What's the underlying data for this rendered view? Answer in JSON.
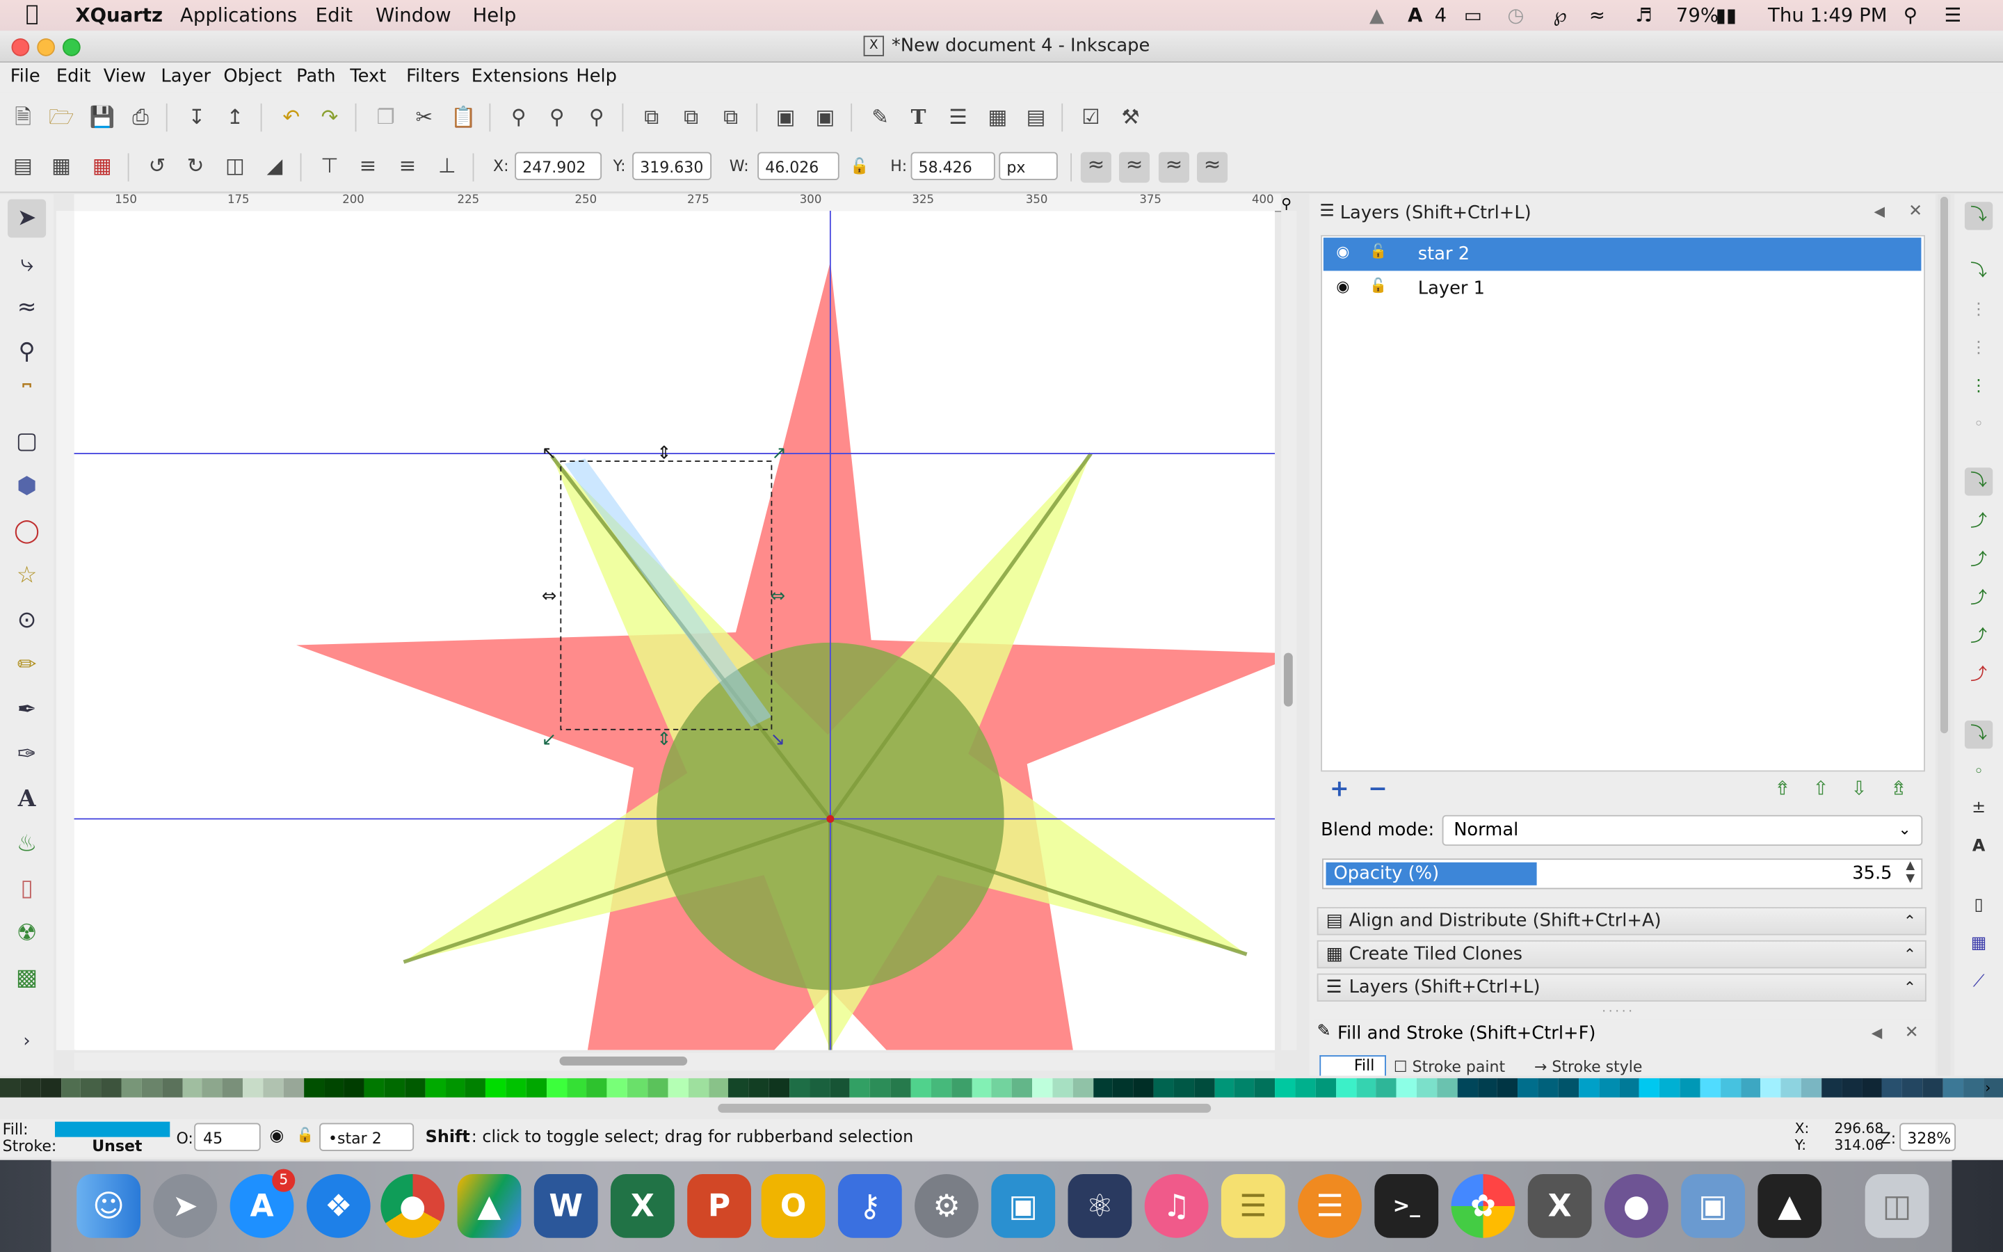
{
  "menubar": {
    "apple": "",
    "app": "XQuartz",
    "items": [
      "Applications",
      "Edit",
      "Window",
      "Help"
    ],
    "status": {
      "adobe_count": "4",
      "battery": "79%",
      "clock": "Thu 1:49 PM"
    }
  },
  "window": {
    "title": "*New document 4 - Inkscape"
  },
  "app_menu": [
    "File",
    "Edit",
    "View",
    "Layer",
    "Object",
    "Path",
    "Text",
    "Filters",
    "Extensions",
    "Help"
  ],
  "toolcontrols": {
    "x_label": "X:",
    "x_value": "247.902",
    "y_label": "Y:",
    "y_value": "319.630",
    "w_label": "W:",
    "w_value": "46.026",
    "h_label": "H:",
    "h_value": "58.426",
    "unit": "px"
  },
  "ruler_top_labels": [
    "150",
    "175",
    "200",
    "225",
    "250",
    "275",
    "300",
    "325",
    "350",
    "375",
    "400"
  ],
  "layers_panel": {
    "title": "Layers (Shift+Ctrl+L)",
    "layers": [
      {
        "name": "star 2",
        "selected": true
      },
      {
        "name": "Layer 1",
        "selected": false
      }
    ],
    "blend_label": "Blend mode:",
    "blend_value": "Normal",
    "opacity_label": "Opacity (%)",
    "opacity_value": "35.5",
    "opacity_fraction": 0.355
  },
  "collapsed_panels": [
    "Align and Distribute (Shift+Ctrl+A)",
    "Create Tiled Clones",
    "Layers (Shift+Ctrl+L)"
  ],
  "fill_stroke_panel": {
    "title": "Fill and Stroke (Shift+Ctrl+F)",
    "tabs": [
      "Fill",
      "Stroke paint",
      "Stroke style"
    ]
  },
  "statusbar": {
    "fill_label": "Fill:",
    "stroke_label": "Stroke:",
    "stroke_value": "Unset",
    "fill_color": "#00a0d8",
    "opacity_label": "O:",
    "opacity_value": "45",
    "layer_value": "•star 2",
    "message_bold": "Shift",
    "message": ": click to toggle select; drag for rubberband selection",
    "cursor_x_label": "X:",
    "cursor_x": "296.68",
    "cursor_y_label": "Y:",
    "cursor_y": "314.06",
    "zoom_label": "Z:",
    "zoom": "328%"
  },
  "dock": {
    "appstore_badge": "5",
    "apps": [
      "finder",
      "launchpad",
      "app-store",
      "safari",
      "chrome",
      "google-drive",
      "word",
      "excel",
      "powerpoint",
      "outlook",
      "xquartz-blue",
      "system-preferences",
      "xcode-helper",
      "atom",
      "itunes",
      "notes",
      "ibooks",
      "terminal",
      "photos",
      "xquartz",
      "github",
      "preview",
      "inkscape",
      "trash"
    ]
  },
  "colors": {
    "star_red": "#ff5a5a",
    "star_yellow": "#ecff8a",
    "circle_green": "#8aa84a",
    "selection_blue": "#3d86d8",
    "guide_blue": "#4a4adf"
  }
}
